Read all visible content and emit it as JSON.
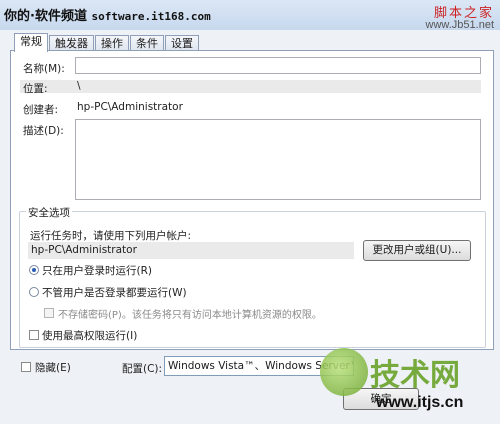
{
  "watermark": {
    "left_text": "你的·软件频道",
    "site": "software.it168.com",
    "right_top": "脚本之家",
    "right_url": "www.Jb51.net",
    "bottom_logo_text": "技术网",
    "bottom_url": "www.itjs.cn"
  },
  "tabs": [
    {
      "label": "常规"
    },
    {
      "label": "触发器"
    },
    {
      "label": "操作"
    },
    {
      "label": "条件"
    },
    {
      "label": "设置"
    }
  ],
  "general": {
    "name_label": "名称(M):",
    "name_value": "",
    "location_label": "位置:",
    "location_value": "\\",
    "author_label": "创建者:",
    "author_value": "hp-PC\\Administrator",
    "description_label": "描述(D):",
    "description_value": ""
  },
  "security": {
    "group_title": "安全选项",
    "run_as_label": "运行任务时，请使用下列用户帐户:",
    "run_as_user": "hp-PC\\Administrator",
    "change_user_button": "更改用户或组(U)...",
    "radio_logged_on": "只在用户登录时运行(R)",
    "radio_whether_logged": "不管用户是否登录都要运行(W)",
    "no_store_password": "不存储密码(P)。该任务将只有访问本地计算机资源的权限。",
    "highest_privileges": "使用最高权限运行(I)",
    "selected_radio": "logged_on"
  },
  "footer": {
    "hidden_label": "隐藏(E)",
    "configure_label": "配置(C):",
    "configure_value": "Windows Vista™、Windows Server™ 2008",
    "ok_button_partial": "确定"
  }
}
